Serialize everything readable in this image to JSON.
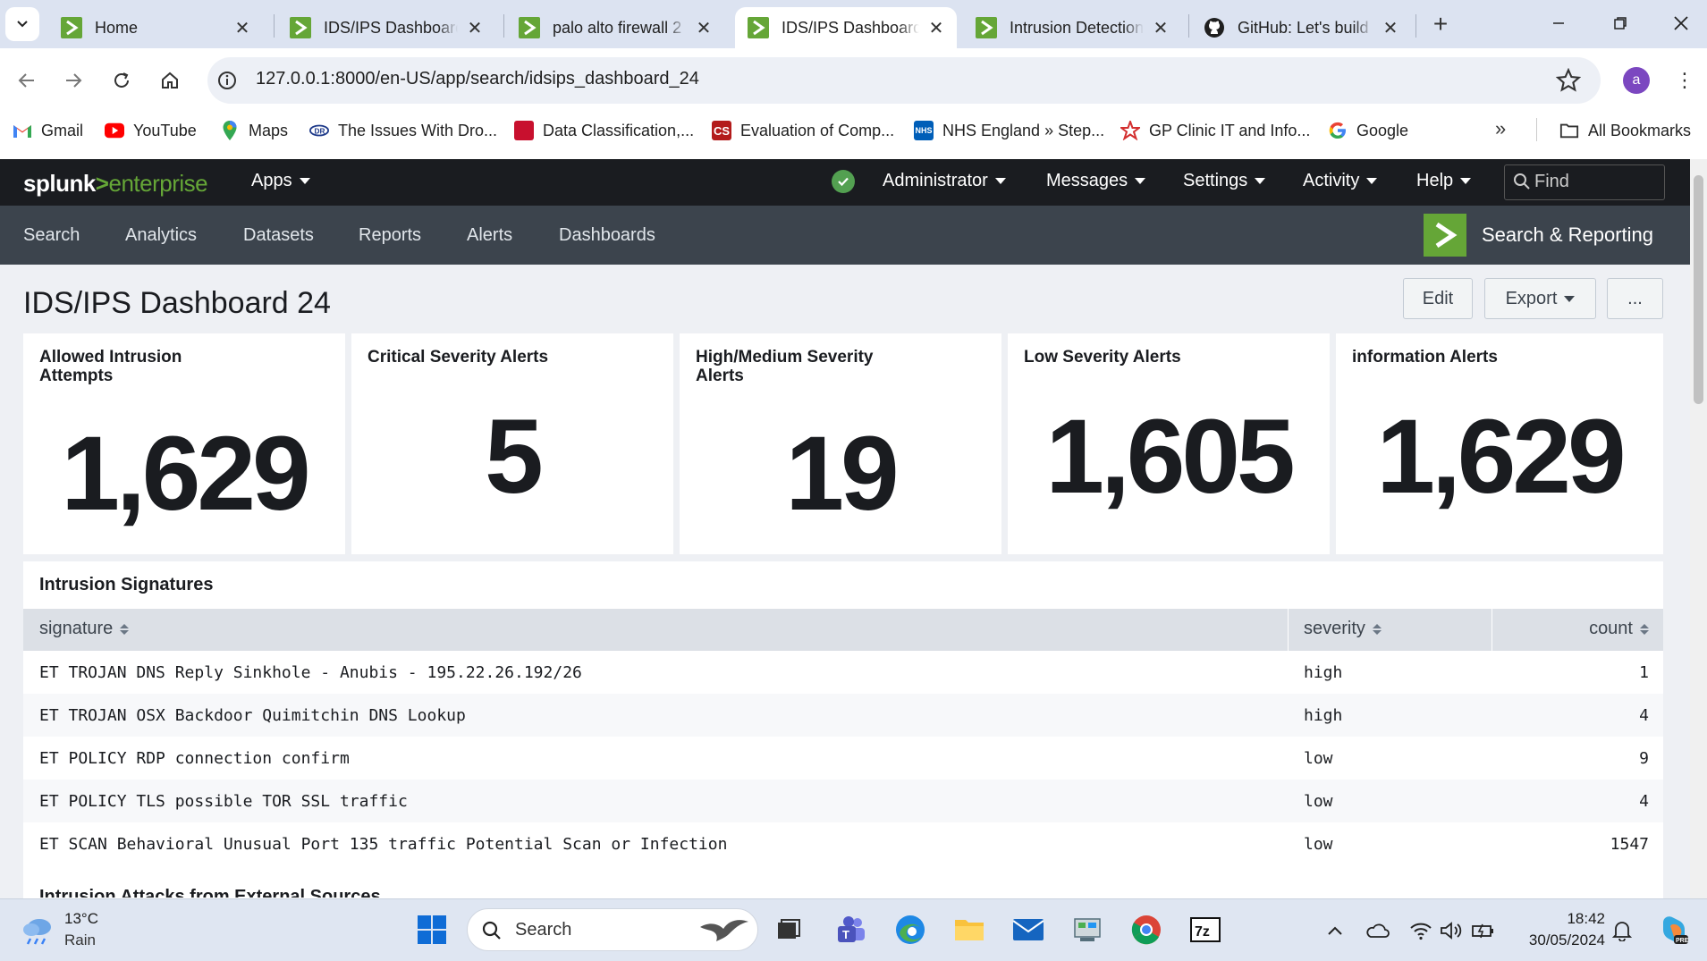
{
  "browser": {
    "tabs": [
      {
        "title": "Home",
        "active": false
      },
      {
        "title": "IDS/IPS Dashboard",
        "active": false
      },
      {
        "title": "palo alto firewall 2",
        "active": false
      },
      {
        "title": "IDS/IPS Dashboard",
        "active": true
      },
      {
        "title": "Intrusion Detection",
        "active": false
      },
      {
        "title": "GitHub: Let's build",
        "active": false
      }
    ],
    "url": "127.0.0.1:8000/en-US/app/search/idsips_dashboard_24",
    "avatar_letter": "a",
    "bookmarks": [
      {
        "label": "Gmail",
        "icon": "gmail-icon"
      },
      {
        "label": "YouTube",
        "icon": "youtube-icon"
      },
      {
        "label": "Maps",
        "icon": "maps-icon"
      },
      {
        "label": "The Issues With Dro...",
        "icon": "site-icon"
      },
      {
        "label": "Data Classification,...",
        "icon": "site-icon"
      },
      {
        "label": "Evaluation of Comp...",
        "icon": "cs-icon"
      },
      {
        "label": "NHS England » Step...",
        "icon": "nhs-icon"
      },
      {
        "label": "GP Clinic IT and Info...",
        "icon": "site-icon"
      },
      {
        "label": "Google",
        "icon": "google-icon"
      }
    ],
    "all_bookmarks": "All Bookmarks"
  },
  "splunk": {
    "logo_splunk": "splunk",
    "logo_gt": ">",
    "logo_enterprise": "enterprise",
    "menu": {
      "apps": "Apps",
      "administrator": "Administrator",
      "messages": "Messages",
      "settings": "Settings",
      "activity": "Activity",
      "help": "Help",
      "find_placeholder": "Find"
    },
    "nav": [
      "Search",
      "Analytics",
      "Datasets",
      "Reports",
      "Alerts",
      "Dashboards"
    ],
    "app_name": "Search & Reporting",
    "accent": "#65a637"
  },
  "dashboard": {
    "title": "IDS/IPS Dashboard 24",
    "buttons": {
      "edit": "Edit",
      "export": "Export",
      "more": "..."
    },
    "single_values": [
      {
        "title": "Allowed Intrusion Attempts",
        "value": "1,629"
      },
      {
        "title": "Critical Severity Alerts",
        "value": "5"
      },
      {
        "title": "High/Medium Severity Alerts",
        "value": "19"
      },
      {
        "title": "Low Severity Alerts",
        "value": "1,605"
      },
      {
        "title": "information Alerts",
        "value": "1,629"
      }
    ],
    "table": {
      "title": "Intrusion Signatures",
      "columns": [
        "signature",
        "severity",
        "count"
      ],
      "rows": [
        [
          "ET TROJAN DNS Reply Sinkhole - Anubis - 195.22.26.192/26",
          "high",
          "1"
        ],
        [
          "ET TROJAN OSX Backdoor Quimitchin DNS Lookup",
          "high",
          "4"
        ],
        [
          "ET POLICY RDP connection confirm",
          "low",
          "9"
        ],
        [
          "ET POLICY TLS possible TOR SSL traffic",
          "low",
          "4"
        ],
        [
          "ET SCAN Behavioral Unusual Port 135 traffic Potential Scan or Infection",
          "low",
          "1547"
        ]
      ]
    },
    "next_panel_title": "Intrusion Attacks from External Sources"
  },
  "taskbar": {
    "weather_temp": "13°C",
    "weather_desc": "Rain",
    "search_placeholder": "Search",
    "time": "18:42",
    "date": "30/05/2024"
  }
}
